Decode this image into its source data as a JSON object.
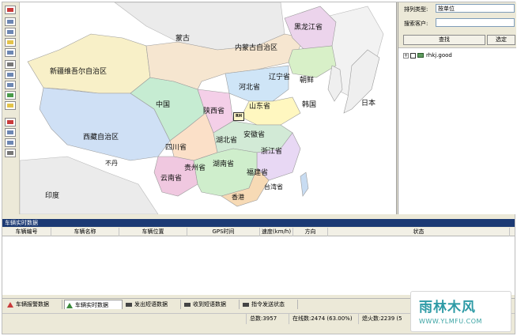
{
  "map_panel": {
    "labels": {
      "mongolia": "蒙古",
      "heilongjiang": "黑龙江省",
      "inner_mongolia": "内蒙古自治区",
      "xinjiang": "新疆维吾尔自治区",
      "liaoning": "辽宁省",
      "hebei": "河北省",
      "north_korea": "朝鲜",
      "qinghai": "中国",
      "shaanxi": "陕西省",
      "shandong": "山东省",
      "south_korea": "韩国",
      "japan": "日本",
      "tibet": "西藏自治区",
      "hubei": "湖北省",
      "anhui": "安徽省",
      "sichuan": "四川省",
      "zhejiang": "浙江省",
      "bhutan": "不丹",
      "guizhou": "贵州省",
      "hunan": "湖南省",
      "fujian": "福建省",
      "yunnan": "云南省",
      "taiwan": "台湾省",
      "india": "印度",
      "hk": "香港"
    },
    "marker_text": "RH"
  },
  "search_panel": {
    "sort_label": "排列类型:",
    "sort_value": "按单位",
    "customer_label": "搜索客户:",
    "customer_value": "",
    "search_button": "查找",
    "select_button": "选定",
    "tree_item": "rhkj.good"
  },
  "table": {
    "title": "车辆实时数据",
    "columns": [
      "车辆编号",
      "车辆名称",
      "车辆位置",
      "GPS时间",
      "速度(km/h)",
      "方向",
      "状态"
    ]
  },
  "tabs": [
    {
      "label": "车辆报警数据",
      "color": "#c93b3b"
    },
    {
      "label": "车辆实时数据",
      "color": "#3a8a3a"
    },
    {
      "label": "发出短语数据",
      "color": "#444444"
    },
    {
      "label": "收到短语数据",
      "color": "#444444"
    },
    {
      "label": "指令发送状态",
      "color": "#444444"
    }
  ],
  "status": {
    "total": "总数:3957",
    "online": "在线数:2474 (63.00%)",
    "engine_off": "熄火数:2239 (5"
  },
  "watermark": {
    "line1": "雨林木风",
    "line2": "WWW.YLMFU.COM"
  }
}
